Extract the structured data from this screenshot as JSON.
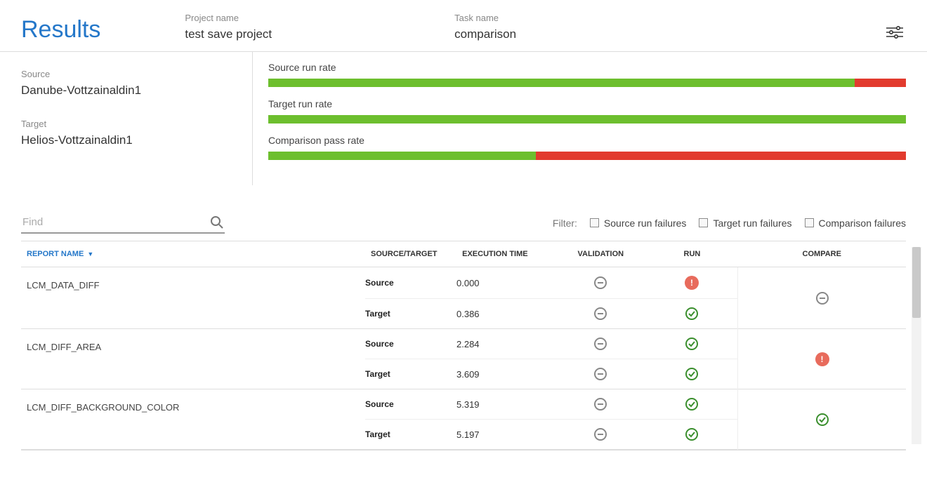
{
  "header": {
    "title": "Results",
    "project_label": "Project name",
    "project_value": "test save project",
    "task_label": "Task name",
    "task_value": "comparison"
  },
  "summary": {
    "source_label": "Source",
    "source_value": "Danube-Vottzainaldin1",
    "target_label": "Target",
    "target_value": "Helios-Vottzainaldin1",
    "rates": [
      {
        "label": "Source run rate",
        "pass_pct": 92
      },
      {
        "label": "Target run rate",
        "pass_pct": 100
      },
      {
        "label": "Comparison pass rate",
        "pass_pct": 42
      }
    ]
  },
  "controls": {
    "find_placeholder": "Find",
    "filter_label": "Filter:",
    "filters": [
      {
        "label": "Source run failures"
      },
      {
        "label": "Target run failures"
      },
      {
        "label": "Comparison failures"
      }
    ]
  },
  "table": {
    "columns": {
      "report_name": "Report Name",
      "source_target": "Source/Target",
      "execution_time": "Execution Time",
      "validation": "Validation",
      "run": "Run",
      "compare": "Compare"
    },
    "rows": [
      {
        "name": "LCM_DATA_DIFF",
        "compare": "neutral",
        "source": {
          "label": "Source",
          "exec_time": "0.000",
          "validation": "neutral",
          "run": "fail"
        },
        "target": {
          "label": "Target",
          "exec_time": "0.386",
          "validation": "neutral",
          "run": "ok"
        }
      },
      {
        "name": "LCM_DIFF_AREA",
        "compare": "fail",
        "source": {
          "label": "Source",
          "exec_time": "2.284",
          "validation": "neutral",
          "run": "ok"
        },
        "target": {
          "label": "Target",
          "exec_time": "3.609",
          "validation": "neutral",
          "run": "ok"
        }
      },
      {
        "name": "LCM_DIFF_BACKGROUND_COLOR",
        "compare": "ok",
        "source": {
          "label": "Source",
          "exec_time": "5.319",
          "validation": "neutral",
          "run": "ok"
        },
        "target": {
          "label": "Target",
          "exec_time": "5.197",
          "validation": "neutral",
          "run": "ok"
        }
      }
    ]
  }
}
